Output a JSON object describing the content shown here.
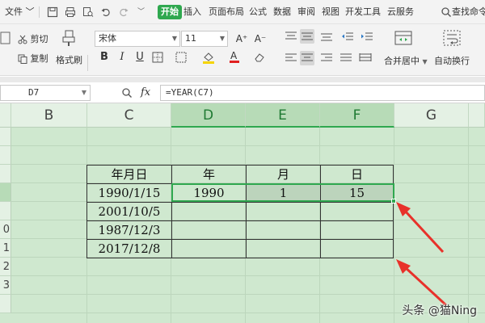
{
  "menubar": {
    "file_label": "文件",
    "tabs": [
      "开始",
      "插入",
      "页面布局",
      "公式",
      "数据",
      "审阅",
      "视图",
      "开发工具",
      "云服务"
    ],
    "search_label": "查找命令"
  },
  "ribbon": {
    "cut_label": "剪切",
    "copy_label": "复制",
    "format_painter_label": "格式刷",
    "font_name": "宋体",
    "font_size": "11",
    "bold_label": "B",
    "italic_label": "I",
    "underline_label": "U",
    "merge_center_label": "合并居中",
    "wrap_text_label": "自动换行"
  },
  "formula_bar": {
    "cell_ref": "D7",
    "fx_label": "fx",
    "formula": "=YEAR(C7)"
  },
  "sheet": {
    "columns": [
      "B",
      "C",
      "D",
      "E",
      "F",
      "G"
    ],
    "selected_columns": [
      "D",
      "E",
      "F"
    ],
    "rows": [
      "",
      "",
      "",
      "",
      "",
      "0",
      "1",
      "2",
      "3"
    ],
    "table": {
      "headers": [
        "年月日",
        "年",
        "月",
        "日"
      ],
      "rows": [
        [
          "1990/1/15",
          "1990",
          "1",
          "15"
        ],
        [
          "2001/10/5",
          "",
          "",
          ""
        ],
        [
          "1987/12/3",
          "",
          "",
          ""
        ],
        [
          "2017/12/8",
          "",
          "",
          ""
        ]
      ]
    }
  },
  "watermark": "头条 @猫Ning",
  "colors": {
    "accent": "#2fa84f",
    "sheet_bg": "#cfe8cf",
    "arrow": "#e8312a"
  }
}
